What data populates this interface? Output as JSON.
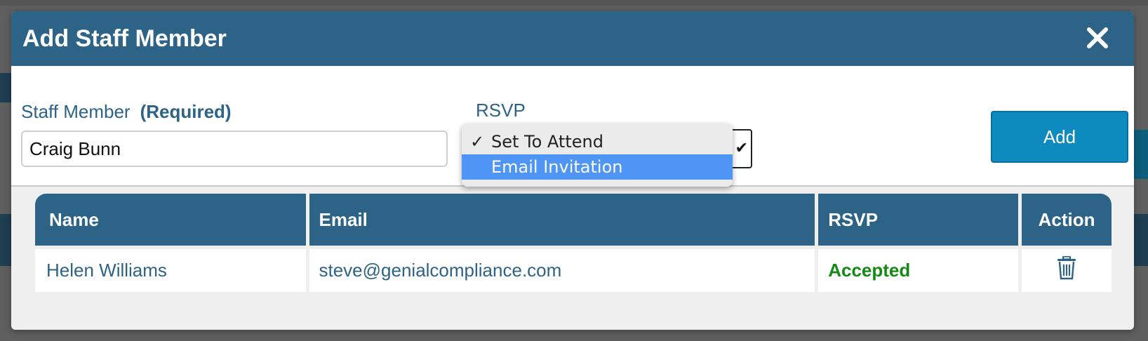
{
  "modal": {
    "title": "Add Staff Member",
    "close_icon": "close-icon"
  },
  "form": {
    "staff_label": "Staff Member",
    "required_label": "(Required)",
    "staff_value": "Craig Bunn",
    "rsvp_label": "RSVP",
    "rsvp_options": [
      {
        "label": "Set To Attend",
        "checked": true
      },
      {
        "label": "Email Invitation",
        "highlighted": true
      }
    ],
    "add_label": "Add"
  },
  "table": {
    "headers": {
      "name": "Name",
      "email": "Email",
      "rsvp": "RSVP",
      "action": "Action"
    },
    "rows": [
      {
        "name": "Helen Williams",
        "email": "steve@genialcompliance.com",
        "rsvp": "Accepted",
        "action_icon": "trash-icon"
      }
    ]
  },
  "colors": {
    "header_bg": "#2d6387",
    "accent_button": "#0e8abf",
    "accepted": "#148a14",
    "dropdown_highlight": "#4e95f5"
  }
}
